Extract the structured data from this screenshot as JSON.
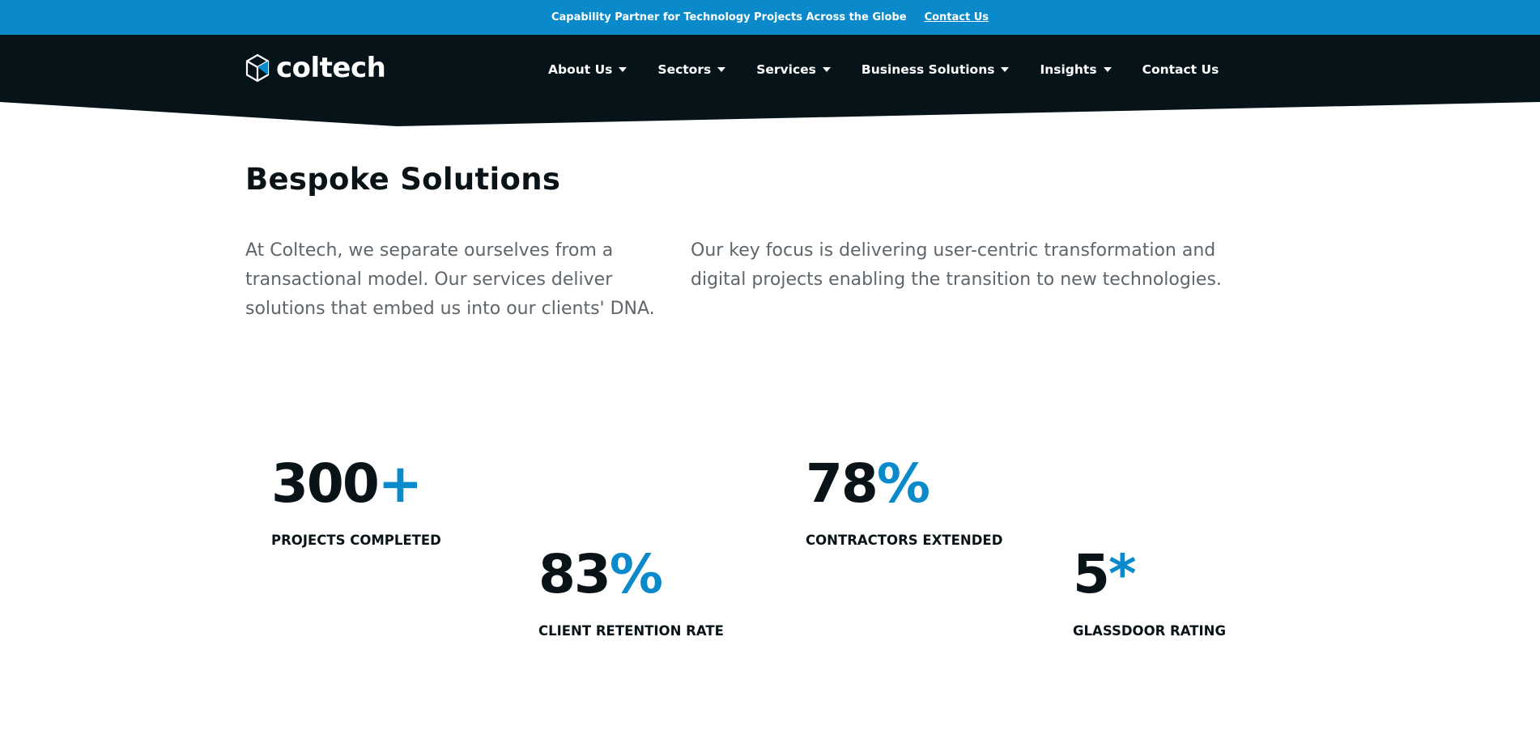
{
  "announcement": {
    "text": "Capability Partner for Technology Projects Across the Globe",
    "link": "Contact Us"
  },
  "brand": {
    "name": "coltech",
    "logo_icon": "cube-logo-icon"
  },
  "nav": {
    "items": [
      {
        "label": "About Us",
        "has_dropdown": true
      },
      {
        "label": "Sectors",
        "has_dropdown": true
      },
      {
        "label": "Services",
        "has_dropdown": true
      },
      {
        "label": "Business Solutions",
        "has_dropdown": true
      },
      {
        "label": "Insights",
        "has_dropdown": true
      },
      {
        "label": "Contact Us",
        "has_dropdown": false
      }
    ]
  },
  "section": {
    "title": "Bespoke Solutions",
    "intro_left": "At Coltech, we separate ourselves from a transactional model. Our services deliver solutions that embed us into our clients' DNA.",
    "intro_right": "Our key focus is delivering user-centric transformation and digital projects enabling the transition to new technologies."
  },
  "stats": [
    {
      "value": "300",
      "suffix": "+",
      "label": "PROJECTS COMPLETED"
    },
    {
      "value": "83",
      "suffix": "%",
      "label": "CLIENT RETENTION RATE"
    },
    {
      "value": "78",
      "suffix": "%",
      "label": "CONTRACTORS EXTENDED"
    },
    {
      "value": "5",
      "suffix": "*",
      "label": "GLASSDOOR RATING"
    }
  ],
  "colors": {
    "accent": "#0a8acb",
    "nav_bg": "#061318",
    "text_dark": "#0a1418",
    "text_muted": "#5e666b"
  }
}
